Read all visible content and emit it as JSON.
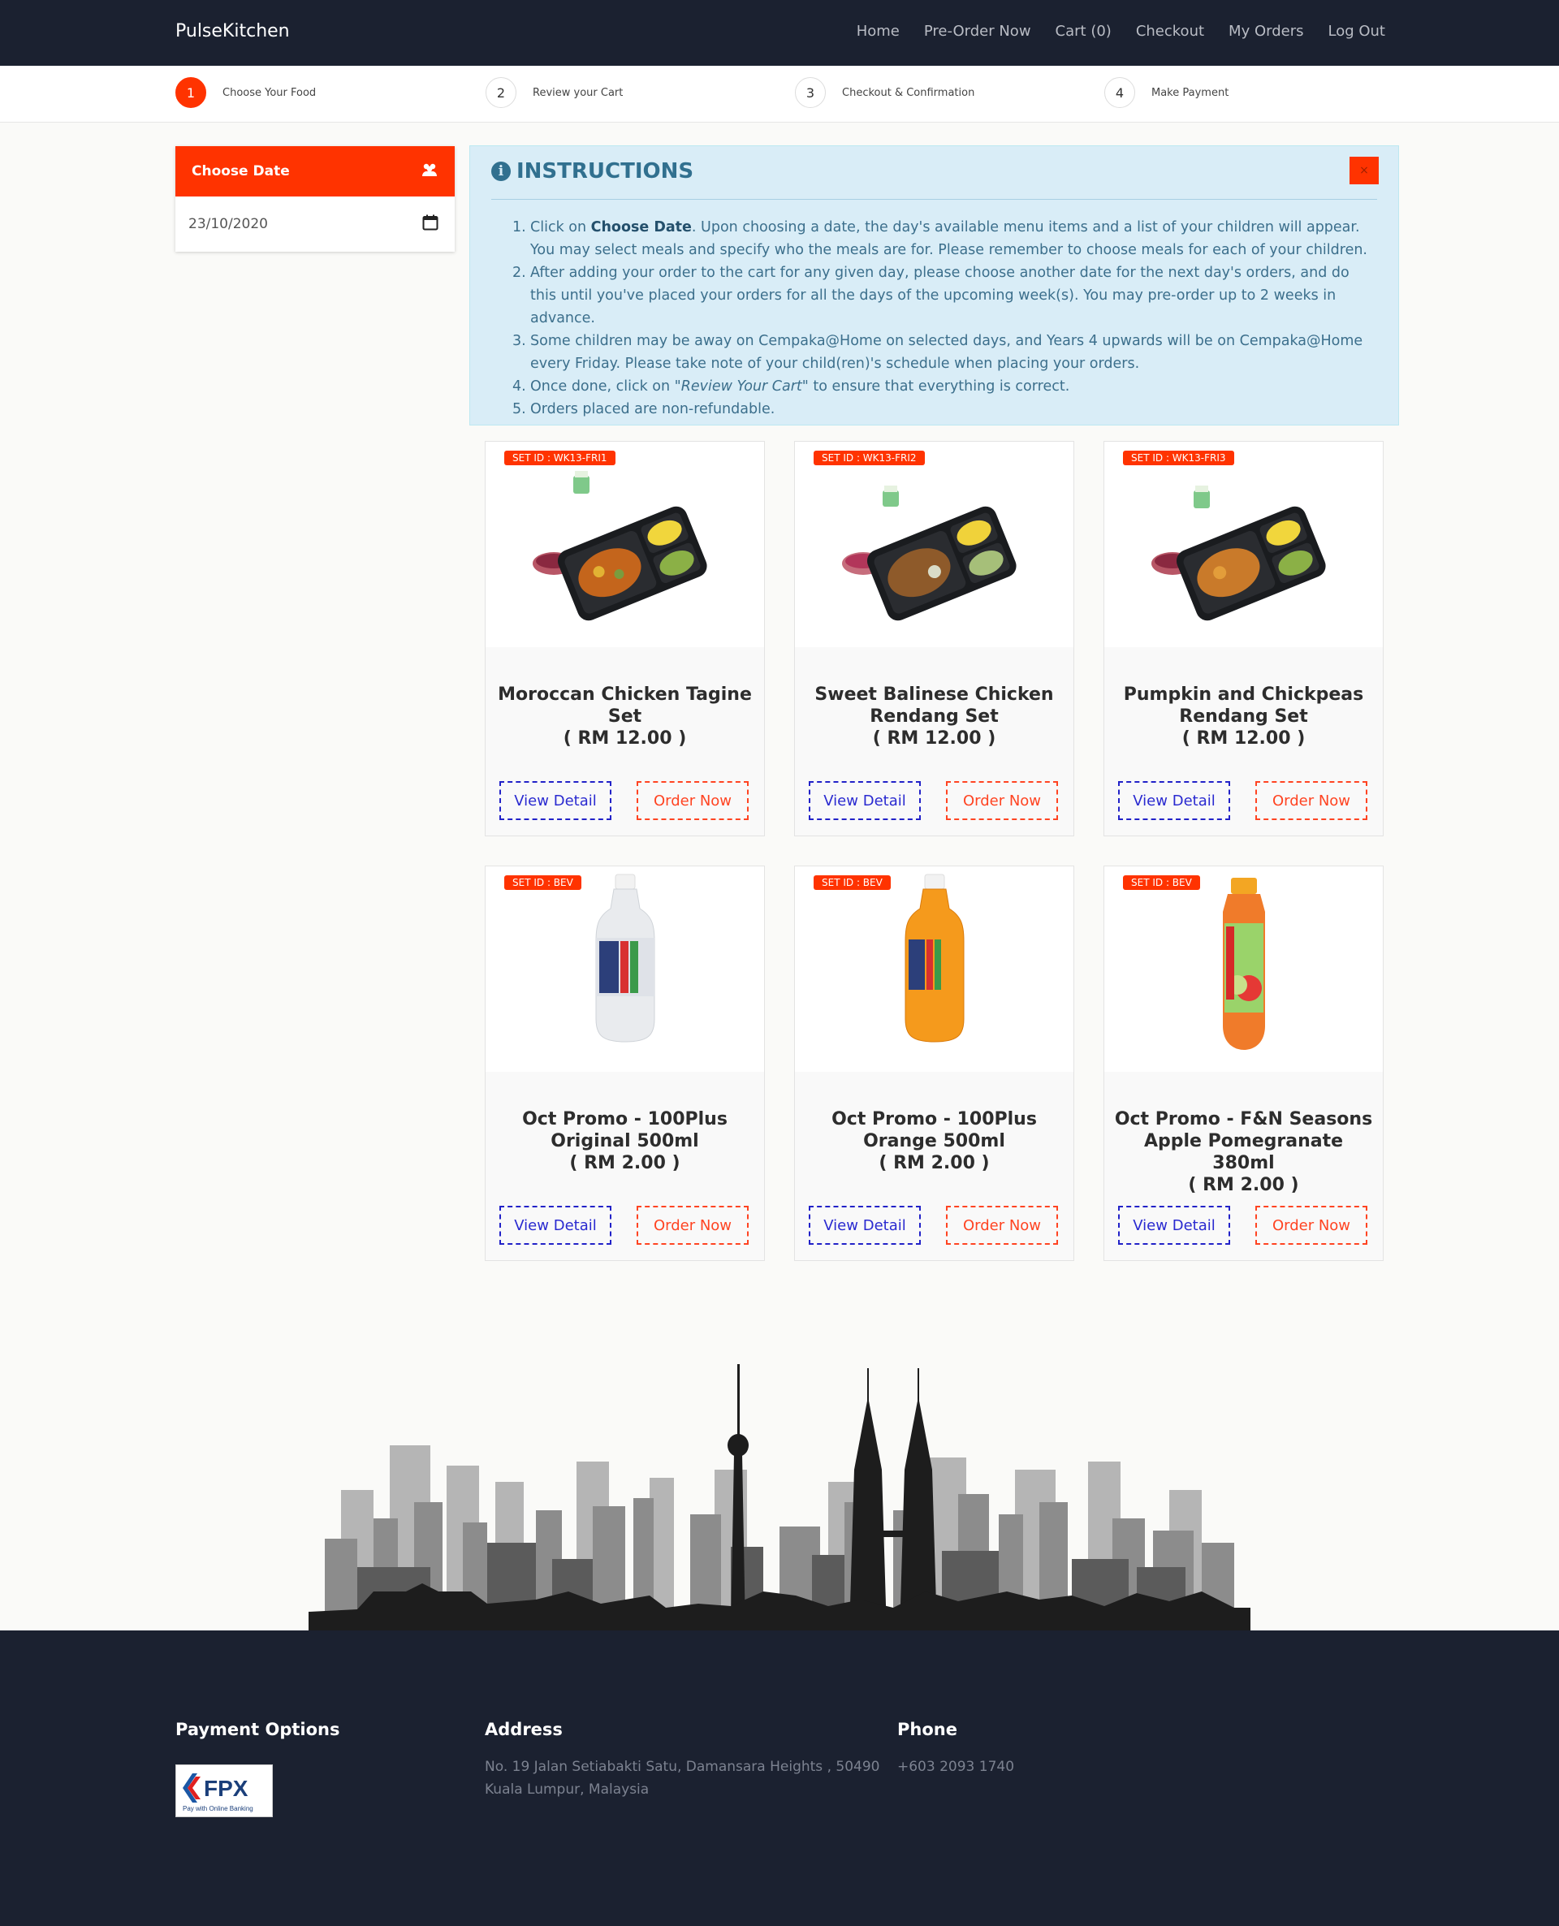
{
  "nav": {
    "brand": "PulseKitchen",
    "links": [
      "Home",
      "Pre-Order Now",
      "Cart (0)",
      "Checkout",
      "My Orders",
      "Log Out"
    ]
  },
  "steps": [
    {
      "num": "1",
      "label": "Choose Your Food",
      "active": true
    },
    {
      "num": "2",
      "label": "Review your Cart",
      "active": false
    },
    {
      "num": "3",
      "label": "Checkout & Confirmation",
      "active": false
    },
    {
      "num": "4",
      "label": "Make Payment",
      "active": false
    }
  ],
  "date_panel": {
    "title": "Choose Date",
    "value": "23/10/2020",
    "icon": "calendar-icon"
  },
  "instructions": {
    "title": "INSTRUCTIONS",
    "close_label": "×",
    "items": [
      {
        "n": "1.",
        "pre": "Click on ",
        "bold": "Choose Date",
        "post": ". Upon choosing a date, the day's available menu items and a list of your children will appear. You may select meals and specify who the meals are for. Please remember to choose meals for each of your children."
      },
      {
        "n": "2.",
        "pre": "After adding your order to the cart for any given day, please choose another date for the next day's orders, and do this until you've placed your orders for all the days of the upcoming week(s). You may pre-order up to 2 weeks in advance.",
        "bold": "",
        "post": ""
      },
      {
        "n": "3.",
        "pre": "Some children may be away on Cempaka@Home on selected days, and Years 4 upwards will be on Cempaka@Home every Friday. Please take note of your child(ren)'s schedule when placing your orders.",
        "bold": "",
        "post": ""
      },
      {
        "n": "4.",
        "pre": "Once done, click on ",
        "italic": "\"Review Your Cart\"",
        "post": " to ensure that everything is correct."
      },
      {
        "n": "5.",
        "pre": "Orders placed are non-refundable.",
        "bold": "",
        "post": ""
      }
    ]
  },
  "products": [
    {
      "set_id": "SET ID : WK13-FRI1",
      "name": "Moroccan Chicken Tagine Set",
      "price": "( RM 12.00 )",
      "kind": "meal"
    },
    {
      "set_id": "SET ID : WK13-FRI2",
      "name": "Sweet Balinese Chicken Rendang Set",
      "price": "( RM 12.00 )",
      "kind": "meal"
    },
    {
      "set_id": "SET ID : WK13-FRI3",
      "name": "Pumpkin and Chickpeas Rendang Set",
      "price": "( RM 12.00 )",
      "kind": "meal"
    },
    {
      "set_id": "SET ID : BEV",
      "name": "Oct Promo - 100Plus Original 500ml",
      "price": "( RM 2.00 )",
      "kind": "bottle-clear"
    },
    {
      "set_id": "SET ID : BEV",
      "name": "Oct Promo - 100Plus Orange 500ml",
      "price": "( RM 2.00 )",
      "kind": "bottle-orange"
    },
    {
      "set_id": "SET ID : BEV",
      "name": "Oct Promo - F&N Seasons Apple Pomegranate 380ml",
      "price": "( RM 2.00 )",
      "kind": "bottle-apple"
    }
  ],
  "buttons": {
    "view": "View Detail",
    "order": "Order Now"
  },
  "footer": {
    "payment_title": "Payment Options",
    "fpx_logo": "FPX",
    "fpx_tagline": "Pay with Online Banking",
    "address_title": "Address",
    "address_line1": "No. 19 Jalan Setiabakti Satu, Damansara Heights , 50490",
    "address_line2": "Kuala Lumpur, Malaysia",
    "phone_title": "Phone",
    "phone": "+603 2093 1740"
  },
  "colors": {
    "accent": "#ff3300",
    "navy": "#1b2130",
    "info_bg": "#d9edf7",
    "info_text": "#31708f",
    "view_blue": "#2222c8"
  }
}
